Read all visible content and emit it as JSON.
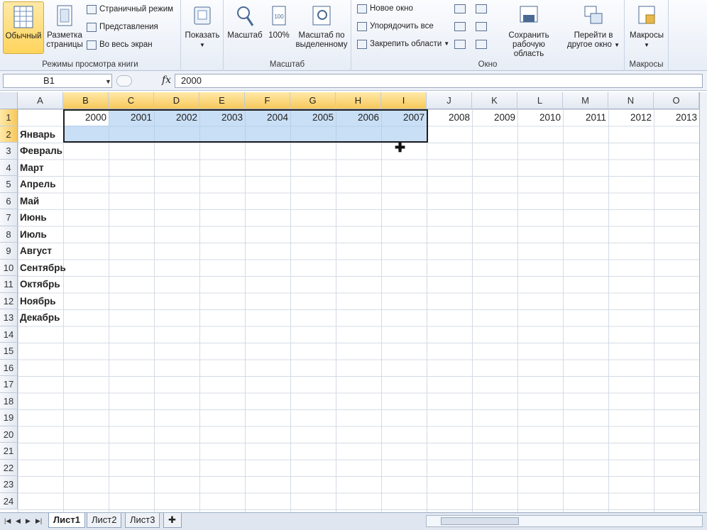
{
  "ribbon": {
    "views": {
      "normal": "Обычный",
      "page_layout_line1": "Разметка",
      "page_layout_line2": "страницы",
      "page_mode": "Страничный режим",
      "custom_views": "Представления",
      "full_screen": "Во весь экран",
      "group_label": "Режимы просмотра книги"
    },
    "show": {
      "label": "Показать"
    },
    "zoom": {
      "zoom": "Масштаб",
      "hundred": "100%",
      "zoom_sel_line1": "Масштаб по",
      "zoom_sel_line2": "выделенному",
      "group_label": "Масштаб"
    },
    "window": {
      "new_window": "Новое окно",
      "arrange_all": "Упорядочить все",
      "freeze_panes": "Закрепить области",
      "save_ws_line1": "Сохранить",
      "save_ws_line2": "рабочую область",
      "switch_line1": "Перейти в",
      "switch_line2": "другое окно",
      "group_label": "Окно"
    },
    "macros": {
      "label": "Макросы",
      "group_label": "Макросы"
    }
  },
  "formula_bar": {
    "name_box": "B1",
    "fx": "fx",
    "formula": "2000"
  },
  "columns": [
    "A",
    "B",
    "C",
    "D",
    "E",
    "F",
    "G",
    "H",
    "I",
    "J",
    "K",
    "L",
    "M",
    "N",
    "O"
  ],
  "rows": [
    "1",
    "2",
    "3",
    "4",
    "5",
    "6",
    "7",
    "8",
    "9",
    "10",
    "11",
    "12",
    "13",
    "14",
    "15",
    "16",
    "17",
    "18",
    "19",
    "20",
    "21",
    "22",
    "23",
    "24"
  ],
  "years": [
    "2000",
    "2001",
    "2002",
    "2003",
    "2004",
    "2005",
    "2006",
    "2007",
    "2008",
    "2009",
    "2010",
    "2011",
    "2012",
    "2013"
  ],
  "months": [
    "Январь",
    "Февраль",
    "Март",
    "Апрель",
    "Май",
    "Июнь",
    "Июль",
    "Август",
    "Сентябрь",
    "Октябрь",
    "Ноябрь",
    "Декабрь"
  ],
  "sheets": [
    "Лист1",
    "Лист2",
    "Лист3"
  ]
}
